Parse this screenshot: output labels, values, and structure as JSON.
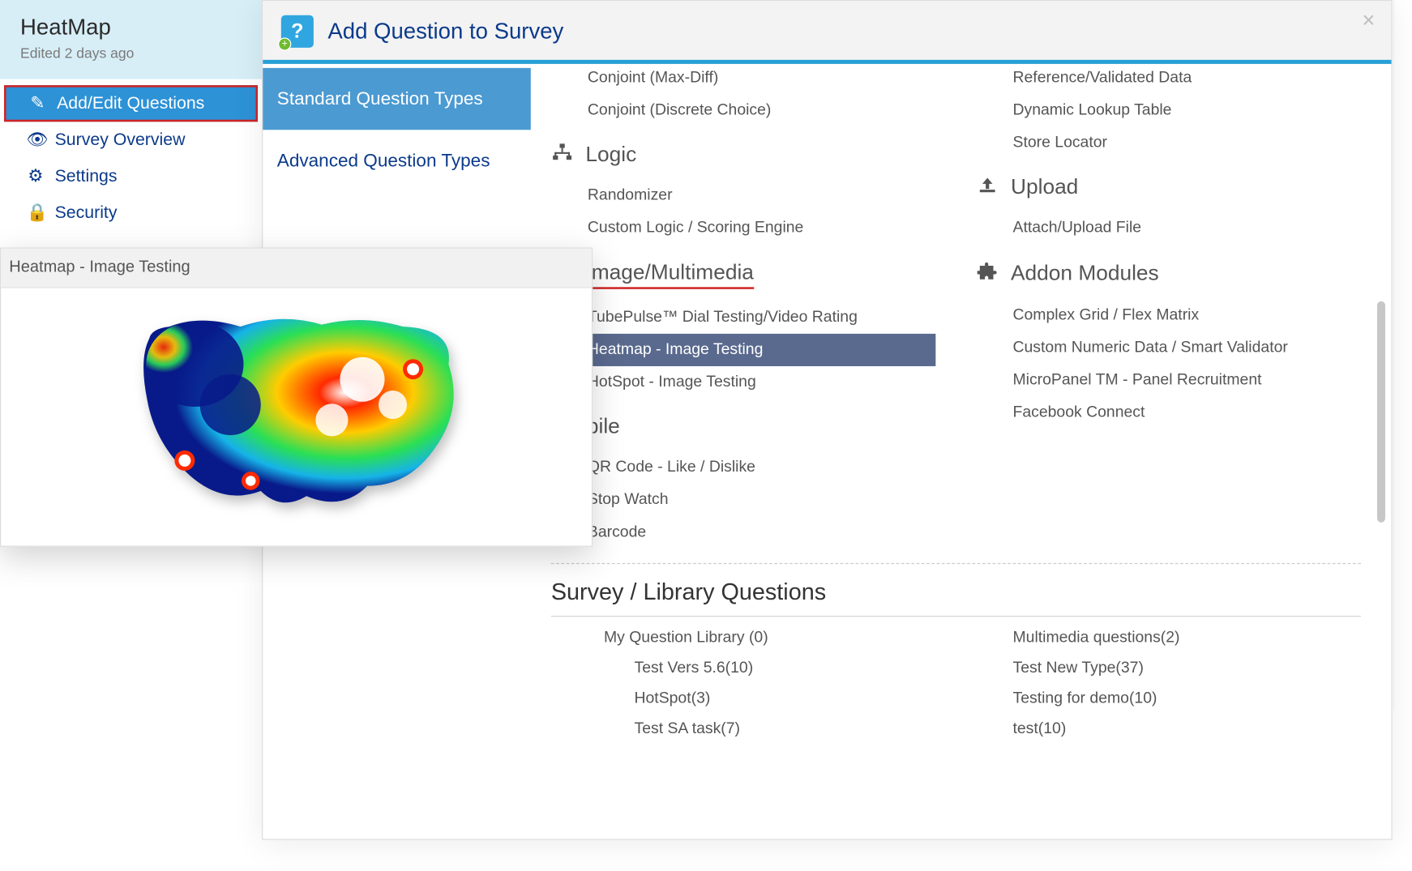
{
  "sidebar": {
    "title": "HeatMap",
    "subtext": "Edited 2 days ago",
    "nav": [
      {
        "id": "edit",
        "label": "Add/Edit Questions",
        "icon": "✎",
        "active": true
      },
      {
        "id": "overview",
        "label": "Survey Overview",
        "icon": "👁",
        "active": false
      },
      {
        "id": "settings",
        "label": "Settings",
        "icon": "⚙",
        "active": false
      },
      {
        "id": "security",
        "label": "Security",
        "icon": "🔒",
        "active": false
      }
    ]
  },
  "panel": {
    "title": "Add Question to Survey",
    "tabs": {
      "standard": "Standard Question Types",
      "advanced": "Advanced Question Types"
    }
  },
  "preview": {
    "title": "Heatmap - Image Testing"
  },
  "categories": {
    "left": {
      "top_cut": [
        "Conjoint (Max-Diff)",
        "Conjoint (Discrete Choice)"
      ],
      "logic": {
        "title": "Logic",
        "items": [
          "Randomizer",
          "Custom Logic / Scoring Engine"
        ]
      },
      "image": {
        "title": "Image/Multimedia",
        "items": [
          "TubePulse™ Dial Testing/Video Rating",
          "Heatmap - Image Testing",
          "HotSpot - Image Testing"
        ],
        "selected_index": 1
      },
      "mobile": {
        "title": "Mobile",
        "items": [
          "QR Code - Like / Dislike",
          "Stop Watch",
          "Barcode"
        ]
      }
    },
    "right": {
      "top_cut": [
        "Reference/Validated Data",
        "Dynamic Lookup Table",
        "Store Locator"
      ],
      "upload": {
        "title": "Upload",
        "items": [
          "Attach/Upload File"
        ]
      },
      "addon": {
        "title": "Addon Modules",
        "items": [
          "Complex Grid / Flex Matrix",
          "Custom Numeric Data / Smart Validator",
          "MicroPanel TM - Panel Recruitment",
          "Facebook Connect"
        ]
      }
    }
  },
  "library": {
    "title": "Survey / Library Questions",
    "left": [
      {
        "label": "My Question Library (0)",
        "sub": false
      },
      {
        "label": "Test Vers 5.6(10)",
        "sub": true
      },
      {
        "label": "HotSpot(3)",
        "sub": true
      },
      {
        "label": "Test SA task(7)",
        "sub": true
      }
    ],
    "right": [
      {
        "label": "Multimedia questions(2)",
        "sub": false
      },
      {
        "label": "Test New Type(37)",
        "sub": false
      },
      {
        "label": "Testing for demo(10)",
        "sub": false
      },
      {
        "label": "test(10)",
        "sub": false
      }
    ]
  }
}
